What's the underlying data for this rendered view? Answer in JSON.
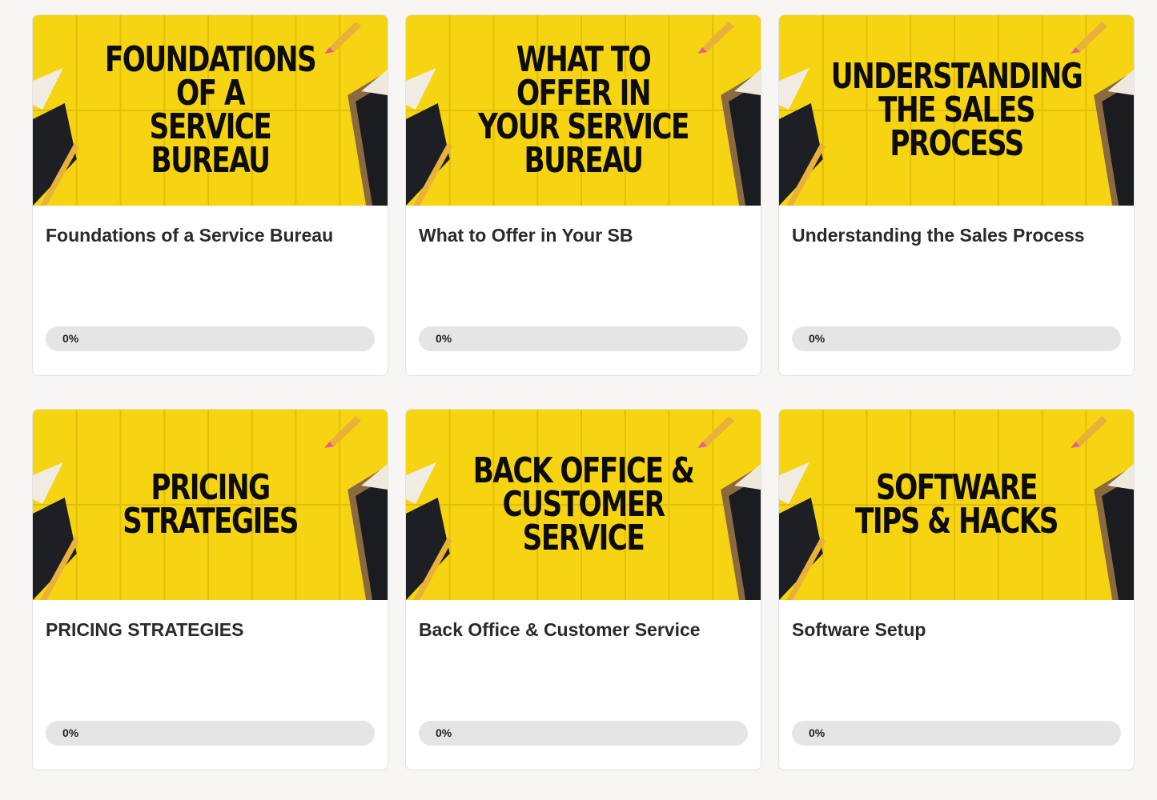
{
  "colors": {
    "page_bg": "#f7f6f5",
    "card_bg": "#ffffff",
    "thumb_yellow": "#f6d411",
    "progress_track": "#e5e5e5"
  },
  "courses": [
    {
      "banner": "FOUNDATIONS OF A\nSERVICE BUREAU",
      "title": "Foundations of a Service Bureau",
      "progress": 0,
      "progress_label": "0%"
    },
    {
      "banner": "WHAT TO OFFER IN\nYOUR SERVICE\nBUREAU",
      "title": "What to Offer in Your SB",
      "progress": 0,
      "progress_label": "0%"
    },
    {
      "banner": "UNDERSTANDING\nTHE SALES PROCESS",
      "title": "Understanding the Sales Process",
      "progress": 0,
      "progress_label": "0%"
    },
    {
      "banner": "PRICING\nSTRATEGIES",
      "title": "PRICING STRATEGIES",
      "progress": 0,
      "progress_label": "0%"
    },
    {
      "banner": "BACK OFFICE &\nCUSTOMER SERVICE",
      "title": "Back Office & Customer Service",
      "progress": 0,
      "progress_label": "0%"
    },
    {
      "banner": "SOFTWARE\nTIPS & HACKS",
      "title": "Software Setup",
      "progress": 0,
      "progress_label": "0%"
    }
  ]
}
